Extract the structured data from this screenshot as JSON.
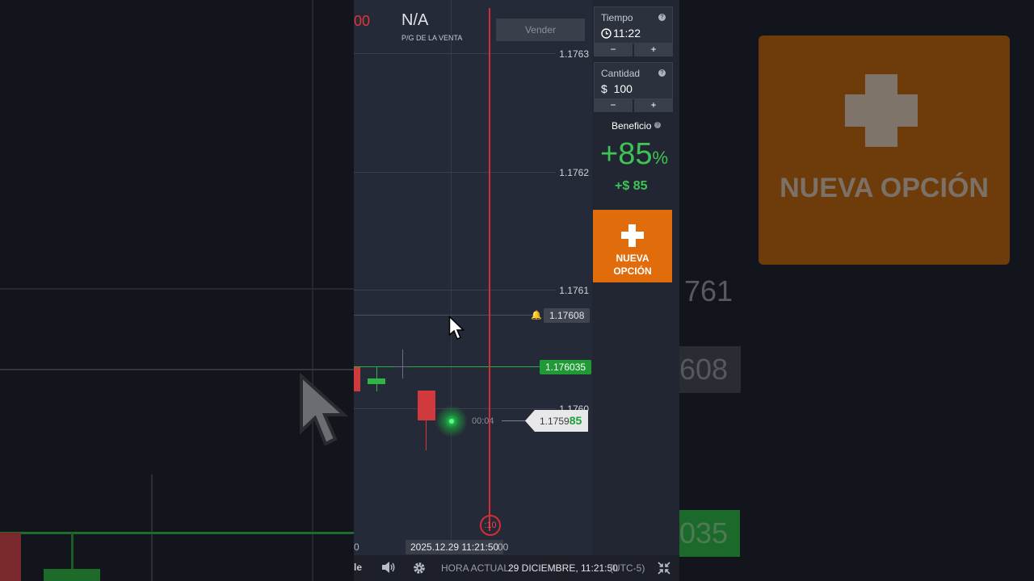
{
  "colors": {
    "accent_orange": "#e06c0c",
    "profit_green": "#3ec455",
    "price_green": "#1f9a35",
    "time_red": "#d12f35",
    "chart_bg": "#252a38"
  },
  "background": {
    "button_text": "NUEVA OPCIÓN",
    "price_1": "761",
    "price_2": "608",
    "price_3": "035"
  },
  "top": {
    "price_fragment": "00",
    "pl_value": "N/A",
    "pl_label": "P/G DE LA VENTA",
    "sell_button": "Vender"
  },
  "chart": {
    "price_labels": [
      "1.1763",
      "1.1762",
      "1.1761",
      "1.1760"
    ],
    "alert_price": "1.17608",
    "current_price": "1.176035",
    "live_price_main": "1.1759",
    "live_price_tail": "85",
    "countdown": "00:04",
    "timer": ":10",
    "date_head": "0",
    "date_tag": "2025.12.29 11:21:50",
    "date_tail": "00"
  },
  "panel": {
    "tiempo_label": "Tiempo",
    "tiempo_value": "11:22",
    "cantidad_label": "Cantidad",
    "cantidad_value": "$  100",
    "minus": "−",
    "plus": "+",
    "beneficio_label": "Beneficio",
    "percent": "+85",
    "percent_sign": "%",
    "profit": "+$ 85",
    "new_option_line1": "NUEVA",
    "new_option_line2": "OPCIÓN"
  },
  "bottom": {
    "fragment": "le",
    "hora_label": "HORA ACTUAL:",
    "hora_value": "29 DICIEMBRE, 11:21:50",
    "timezone": "(UTC-5)"
  },
  "icons": [
    "clock-icon",
    "help-icon",
    "bell-icon",
    "sound-icon",
    "gear-icon",
    "collapse-icon",
    "cursor-icon"
  ]
}
